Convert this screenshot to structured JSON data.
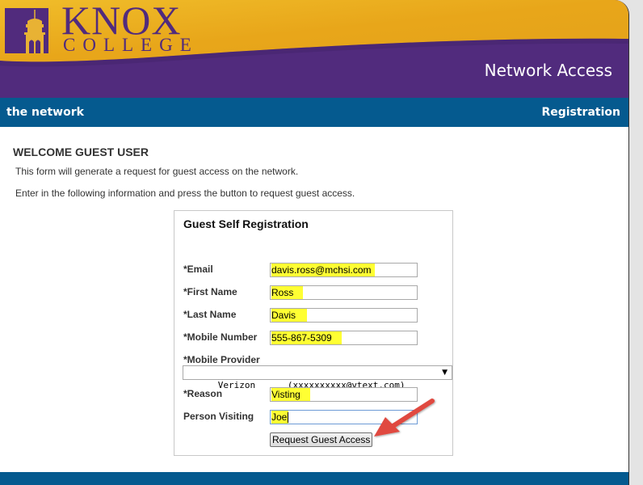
{
  "header": {
    "logo_word": "KNOX",
    "logo_subword": "COLLEGE",
    "title": "Network Access"
  },
  "navbar": {
    "left_label": "the network",
    "right_label": "Registration"
  },
  "intro": {
    "heading": "WELCOME GUEST USER",
    "line1": "This form will generate a request for guest access on the network.",
    "line2": "Enter in the following information and press the button to request guest access."
  },
  "form": {
    "title": "Guest Self Registration",
    "fields": {
      "email": {
        "label": "*Email",
        "value": "davis.ross@mchsi.com"
      },
      "first_name": {
        "label": "*First Name",
        "value": "Ross"
      },
      "last_name": {
        "label": "*Last Name",
        "value": "Davis"
      },
      "mobile_number": {
        "label": "*Mobile Number",
        "value": "555-867-5309"
      },
      "mobile_provider": {
        "label": "*Mobile Provider",
        "value": "Verizon      (xxxxxxxxxx@vtext.com)"
      },
      "reason": {
        "label": "*Reason",
        "value": "Visting"
      },
      "person_visiting": {
        "label": "Person Visiting",
        "value": "Joe"
      }
    },
    "submit_label": "Request Guest Access"
  },
  "colors": {
    "brand_purple": "#512b7d",
    "brand_gold": "#e6a817",
    "nav_blue": "#055a8f",
    "highlight_yellow": "#ffff33",
    "annotation_red": "#e04a3f"
  }
}
